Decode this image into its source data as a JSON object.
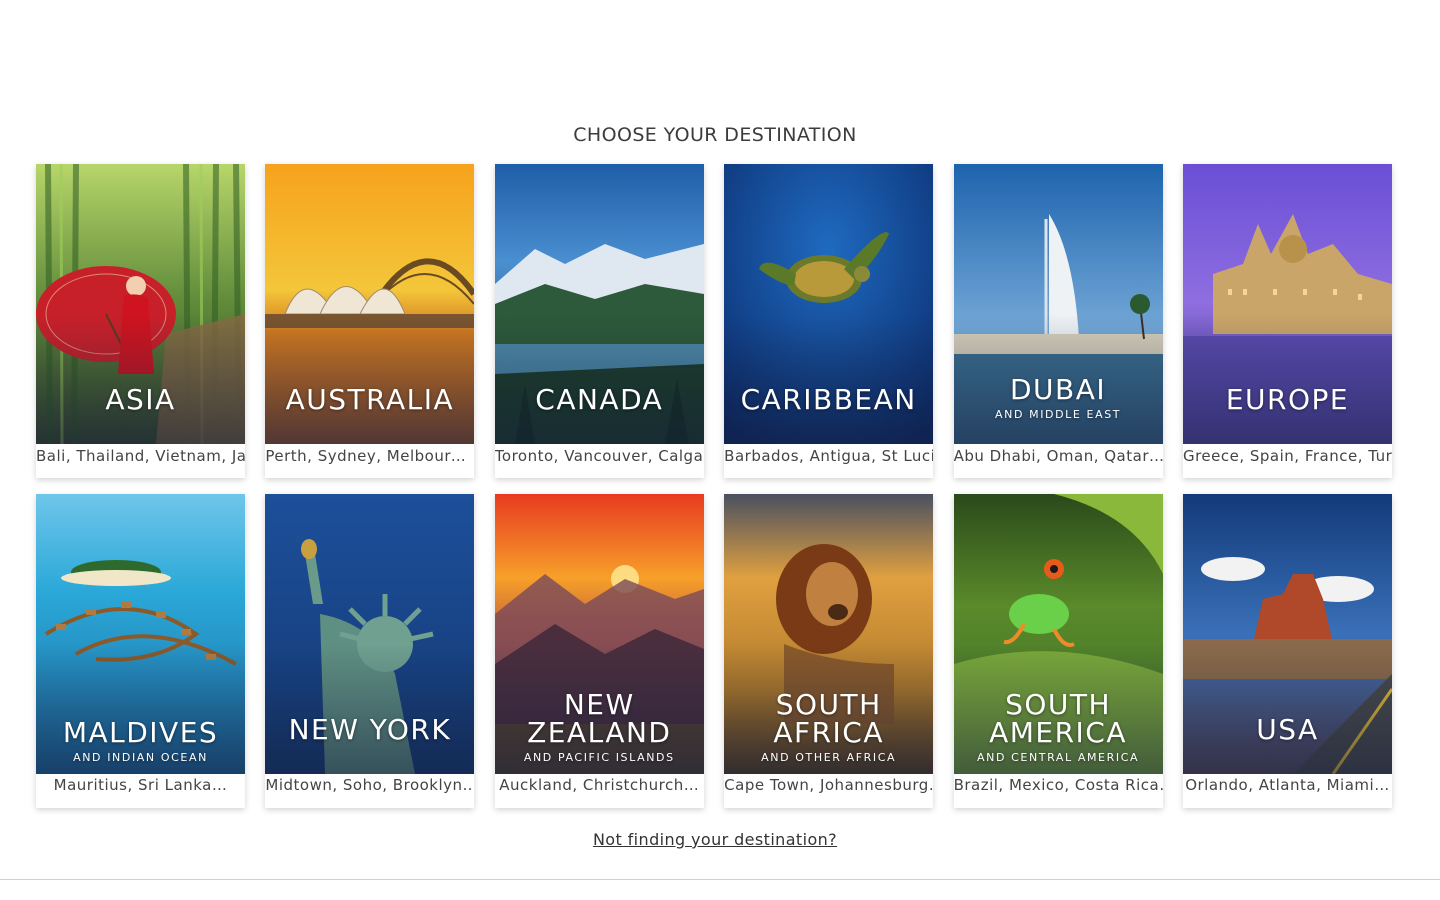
{
  "section_title": "CHOOSE YOUR DESTINATION",
  "not_finding_link": "Not finding your destination?",
  "destinations": [
    {
      "name": "ASIA",
      "subtitle": "",
      "places": "Bali, Thailand, Vietnam, Japan",
      "scene": "asia-bamboo-umbrella"
    },
    {
      "name": "AUSTRALIA",
      "subtitle": "",
      "places": "Perth, Sydney, Melbourne…",
      "scene": "sydney-opera-house"
    },
    {
      "name": "CANADA",
      "subtitle": "",
      "places": "Toronto, Vancouver, Calgary",
      "scene": "mountain-lake"
    },
    {
      "name": "CARIBBEAN",
      "subtitle": "",
      "places": "Barbados, Antigua, St Lucia",
      "scene": "sea-turtle"
    },
    {
      "name": "DUBAI",
      "subtitle": "AND MIDDLE EAST",
      "places": "Abu Dhabi, Oman, Qatar…",
      "scene": "burj-al-arab"
    },
    {
      "name": "EUROPE",
      "subtitle": "",
      "places": "Greece, Spain, France, Turkey",
      "scene": "budapest-parliament"
    },
    {
      "name": "MALDIVES",
      "subtitle": "AND INDIAN OCEAN",
      "places": "Mauritius, Sri Lanka…",
      "scene": "water-villas"
    },
    {
      "name": "NEW YORK",
      "subtitle": "",
      "places": "Midtown, Soho, Brooklyn…",
      "scene": "statue-of-liberty"
    },
    {
      "name": "NEW\nZEALAND",
      "subtitle": "AND PACIFIC ISLANDS",
      "places": "Auckland, Christchurch…",
      "scene": "sunset-mountains"
    },
    {
      "name": "SOUTH\nAFRICA",
      "subtitle": "AND OTHER AFRICA",
      "places": "Cape Town, Johannesburg…",
      "scene": "lion"
    },
    {
      "name": "SOUTH\nAMERICA",
      "subtitle": "AND CENTRAL AMERICA",
      "places": "Brazil, Mexico, Costa Rica…",
      "scene": "tree-frog"
    },
    {
      "name": "USA",
      "subtitle": "",
      "places": "Orlando, Atlanta, Miami…",
      "scene": "monument-valley"
    }
  ]
}
